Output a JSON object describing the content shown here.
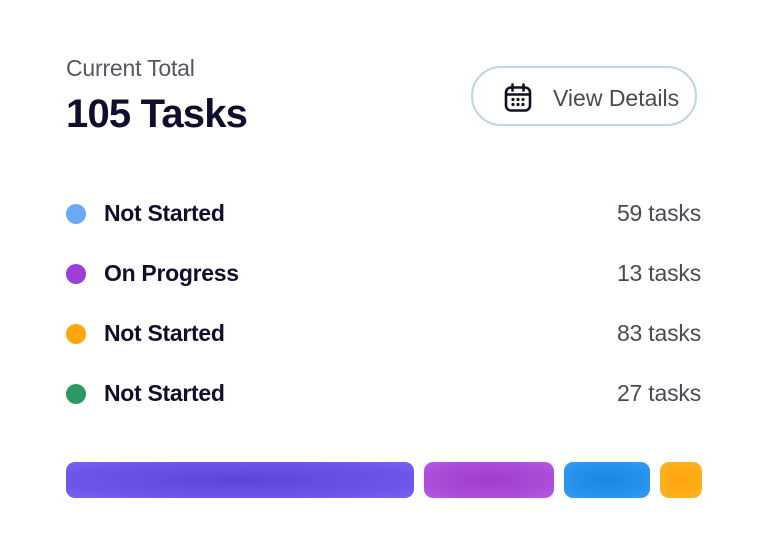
{
  "header": {
    "subtitle": "Current Total",
    "total": "105 Tasks"
  },
  "view_button": {
    "label": "View Details",
    "icon": "calendar-icon"
  },
  "legend": [
    {
      "label": "Not Started",
      "count": "59 tasks",
      "color": "#6aa9f5"
    },
    {
      "label": "On Progress",
      "count": "13 tasks",
      "color": "#9b3fd6"
    },
    {
      "label": "Not Started",
      "count": "83 tasks",
      "color": "#ffa60d"
    },
    {
      "label": "Not Started",
      "count": "27 tasks",
      "color": "#2a9963"
    }
  ],
  "progress_bar": {
    "segments": [
      {
        "color": "#6a52e8",
        "share": 0.56
      },
      {
        "color": "#a847d6",
        "share": 0.21
      },
      {
        "color": "#2590ec",
        "share": 0.14
      },
      {
        "color": "#ffab18",
        "share": 0.07
      }
    ]
  }
}
